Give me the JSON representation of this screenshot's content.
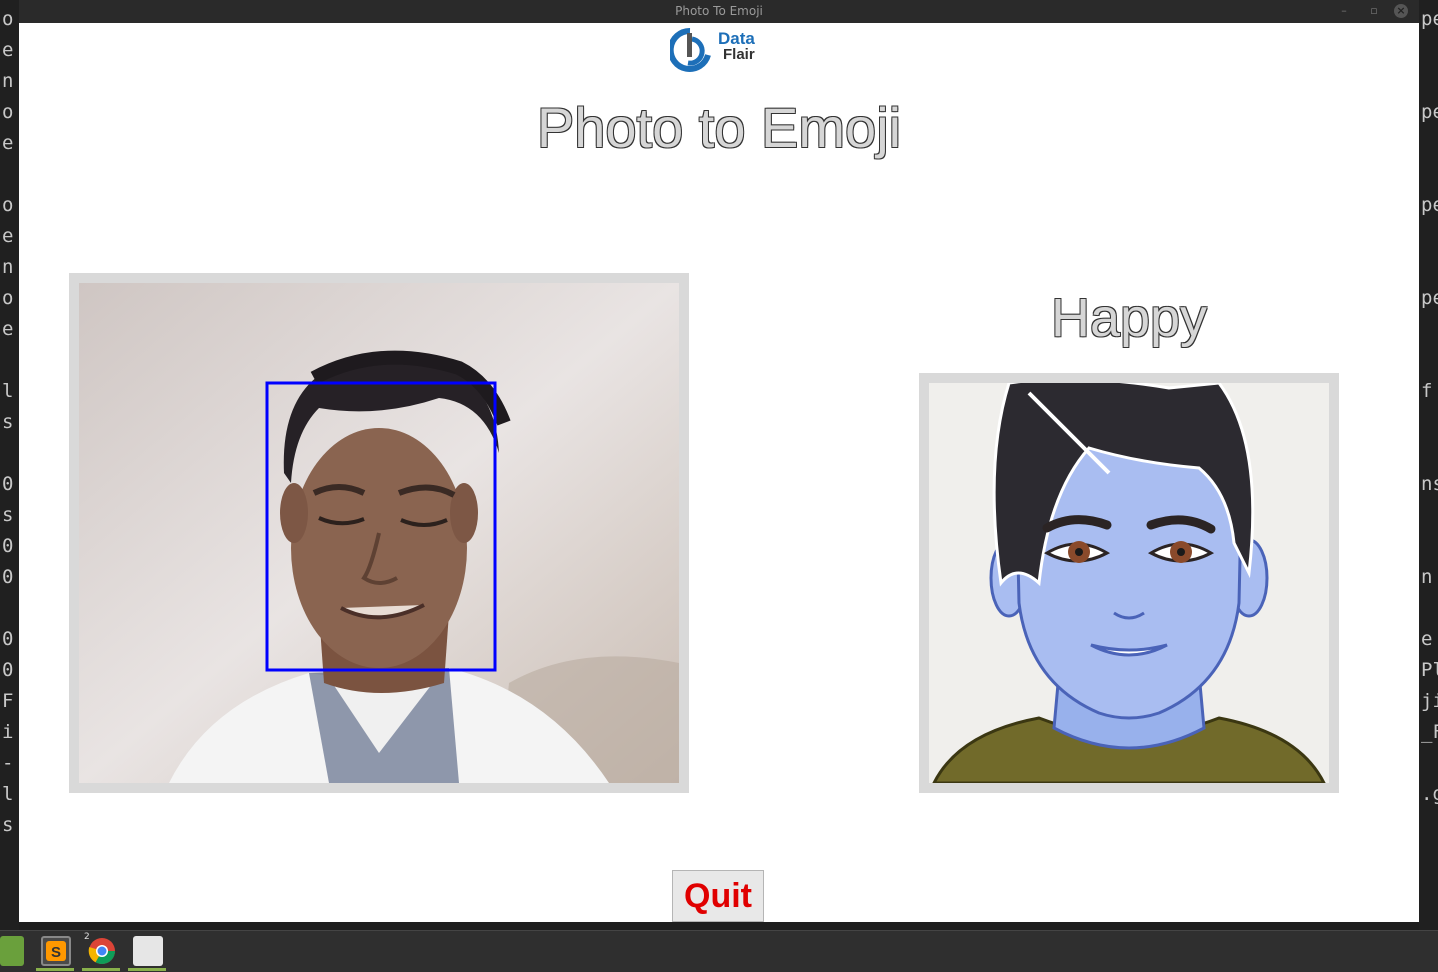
{
  "window": {
    "title": "Photo To Emoji"
  },
  "logo": {
    "line1": "Data",
    "line2": "Flair"
  },
  "heading": "Photo to Emoji",
  "emotion_label": "Happy",
  "quit_label": "Quit",
  "background_terminal": {
    "left_fragments": [
      "o",
      "e",
      "n",
      "o",
      "e",
      "",
      "o",
      "e",
      "n",
      "o",
      "e",
      "",
      "l",
      "s",
      "",
      "0",
      "s",
      "0",
      "0",
      "",
      "0",
      "0",
      "F",
      "i",
      "-",
      "l",
      "s"
    ],
    "right_fragments": [
      "pe",
      "",
      "",
      "pe",
      "",
      "",
      "pe",
      "",
      "",
      "pe",
      "",
      "",
      "f",
      "",
      "",
      "ns",
      "",
      "",
      "n",
      "",
      "e",
      "Pl",
      "ji",
      "_F",
      "",
      ".g",
      ""
    ]
  },
  "taskbar": {
    "chrome_badge": "2"
  },
  "colors": {
    "face_box": "#0000ff",
    "quit_text": "#e00000",
    "avatar_skin": "#a9bdf1"
  }
}
